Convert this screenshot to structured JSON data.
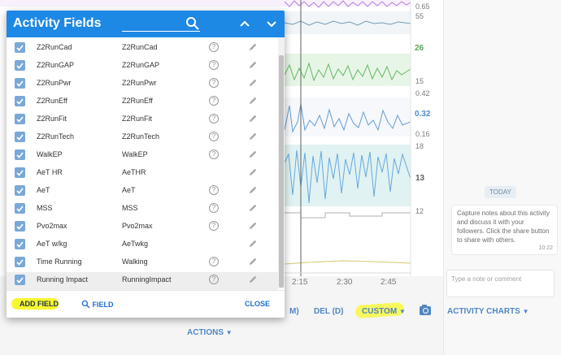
{
  "dialog": {
    "title": "Activity Fields",
    "add_field_label": "ADD FIELD",
    "field_label": "FIELD",
    "close_label": "CLOSE",
    "help_glyph": "?",
    "rows": [
      {
        "name": "Z2RunCad",
        "code": "Z2RunCad",
        "checked": true,
        "has_help": true
      },
      {
        "name": "Z2RunGAP",
        "code": "Z2RunGAP",
        "checked": true,
        "has_help": true
      },
      {
        "name": "Z2RunPwr",
        "code": "Z2RunPwr",
        "checked": true,
        "has_help": true
      },
      {
        "name": "Z2RunEff",
        "code": "Z2RunEff",
        "checked": true,
        "has_help": true
      },
      {
        "name": "Z2RunFit",
        "code": "Z2RunFit",
        "checked": true,
        "has_help": true
      },
      {
        "name": "Z2RunTech",
        "code": "Z2RunTech",
        "checked": true,
        "has_help": true
      },
      {
        "name": "WalkEP",
        "code": "WalkEP",
        "checked": true,
        "has_help": true
      },
      {
        "name": "AeT HR",
        "code": "AeTHR",
        "checked": true,
        "has_help": false
      },
      {
        "name": "AeT",
        "code": "AeT",
        "checked": true,
        "has_help": true
      },
      {
        "name": "MSS",
        "code": "MSS",
        "checked": true,
        "has_help": true
      },
      {
        "name": "Pvo2max",
        "code": "Pvo2max",
        "checked": true,
        "has_help": true
      },
      {
        "name": "AeT w/kg",
        "code": "AeTwkg",
        "checked": true,
        "has_help": false
      },
      {
        "name": "Time Running",
        "code": "Walking",
        "checked": true,
        "has_help": true
      },
      {
        "name": "Running Impact",
        "code": "RunningImpact",
        "checked": true,
        "has_help": true,
        "selected": true
      }
    ]
  },
  "chart": {
    "y_labels": [
      "0.65",
      "55",
      "26",
      "15",
      "0.42",
      "0.32",
      "0.16",
      "18",
      "13",
      "12"
    ],
    "x_labels": [
      "2:15",
      "2:30",
      "2:45"
    ]
  },
  "toolbar": {
    "m_label": "M)",
    "del_label": "DEL (D)",
    "custom_label": "CUSTOM",
    "activity_charts_label": "ACTIVITY CHARTS",
    "actions_label": "ACTIONS"
  },
  "side": {
    "today_label": "TODAY",
    "bubble_text": "Capture notes about this activity and discuss it with your followers. Click the share button to share with others.",
    "bubble_time": "10:22",
    "note_placeholder": "Type a note or comment"
  },
  "colors": {
    "header": "#1e88e5",
    "accent": "#1e6fd0",
    "highlight": "#f7f730",
    "checkbox": "#7aa8d8"
  }
}
